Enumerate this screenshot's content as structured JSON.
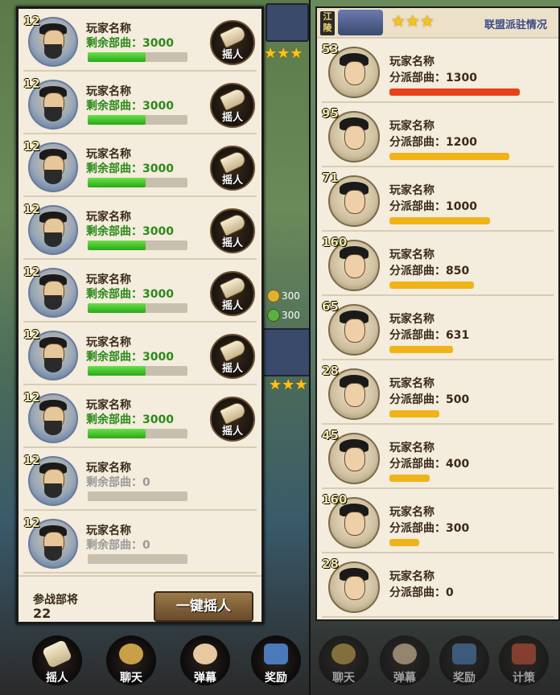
{
  "left": {
    "stars": "★★★",
    "resources": [
      {
        "value": "300"
      },
      {
        "value": "300"
      }
    ],
    "rows": [
      {
        "level": "12",
        "name": "玩家名称",
        "info": "剩余部曲：3000",
        "progress": 0.58,
        "active": true,
        "button": "摇人"
      },
      {
        "level": "12",
        "name": "玩家名称",
        "info": "剩余部曲：3000",
        "progress": 0.58,
        "active": true,
        "button": "摇人"
      },
      {
        "level": "12",
        "name": "玩家名称",
        "info": "剩余部曲：3000",
        "progress": 0.58,
        "active": true,
        "button": "摇人"
      },
      {
        "level": "12",
        "name": "玩家名称",
        "info": "剩余部曲：3000",
        "progress": 0.58,
        "active": true,
        "button": "摇人"
      },
      {
        "level": "12",
        "name": "玩家名称",
        "info": "剩余部曲：3000",
        "progress": 0.58,
        "active": true,
        "button": "摇人"
      },
      {
        "level": "12",
        "name": "玩家名称",
        "info": "剩余部曲：3000",
        "progress": 0.58,
        "active": true,
        "button": "摇人"
      },
      {
        "level": "12",
        "name": "玩家名称",
        "info": "剩余部曲：3000",
        "progress": 0.58,
        "active": true,
        "button": "摇人"
      },
      {
        "level": "12",
        "name": "玩家名称",
        "info": "剩余部曲：0",
        "progress": 0,
        "active": false,
        "button": ""
      },
      {
        "level": "12",
        "name": "玩家名称",
        "info": "剩余部曲：0",
        "progress": 0,
        "active": false,
        "button": ""
      }
    ],
    "footer": {
      "label": "参战部将",
      "count": "22",
      "button": "一键摇人"
    },
    "nav": [
      "摇人",
      "聊天",
      "弹幕",
      "奖励"
    ]
  },
  "right": {
    "city": "江陵",
    "stars": "★★★",
    "title": "联盟派驻情况",
    "rows": [
      {
        "level": "53",
        "name": "玩家名称",
        "info": "分派部曲：1300",
        "progress": 1.0,
        "color": "#e8401a"
      },
      {
        "level": "95",
        "name": "玩家名称",
        "info": "分派部曲：1200",
        "progress": 0.92,
        "color": "#f0b418"
      },
      {
        "level": "71",
        "name": "玩家名称",
        "info": "分派部曲：1000",
        "progress": 0.77,
        "color": "#f0b418"
      },
      {
        "level": "160",
        "name": "玩家名称",
        "info": "分派部曲：850",
        "progress": 0.65,
        "color": "#f0b418"
      },
      {
        "level": "65",
        "name": "玩家名称",
        "info": "分派部曲：631",
        "progress": 0.49,
        "color": "#f0b418"
      },
      {
        "level": "28",
        "name": "玩家名称",
        "info": "分派部曲：500",
        "progress": 0.38,
        "color": "#f0b418"
      },
      {
        "level": "45",
        "name": "玩家名称",
        "info": "分派部曲：400",
        "progress": 0.31,
        "color": "#f0b418"
      },
      {
        "level": "160",
        "name": "玩家名称",
        "info": "分派部曲：300",
        "progress": 0.23,
        "color": "#f0b418"
      },
      {
        "level": "28",
        "name": "玩家名称",
        "info": "分派部曲：0",
        "progress": 0,
        "color": "#f0b418"
      }
    ],
    "nav": [
      "聊天",
      "弹幕",
      "奖励",
      "计策"
    ]
  }
}
